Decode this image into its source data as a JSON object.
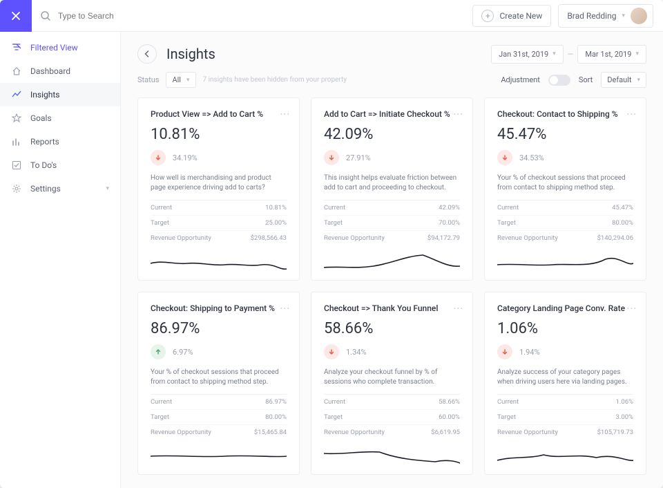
{
  "topbar": {
    "search_placeholder": "Type to Search",
    "create_label": "Create New",
    "user_name": "Brad Redding"
  },
  "sidebar": {
    "items": [
      {
        "label": "Filtered View",
        "icon": "filter"
      },
      {
        "label": "Dashboard",
        "icon": "home"
      },
      {
        "label": "Insights",
        "icon": "trend"
      },
      {
        "label": "Goals",
        "icon": "star"
      },
      {
        "label": "Reports",
        "icon": "bars"
      },
      {
        "label": "To Do's",
        "icon": "check"
      },
      {
        "label": "Settings",
        "icon": "gear"
      }
    ]
  },
  "header": {
    "title": "Insights",
    "date_from": "Jan 31st, 2019",
    "date_to": "Mar 1st, 2019"
  },
  "filter": {
    "status_label": "Status",
    "status_value": "All",
    "hidden_note": "7 insights have been hidden from your property",
    "adjustment_label": "Adjustment",
    "sort_label": "Sort",
    "sort_value": "Default"
  },
  "stat_labels": {
    "current": "Current",
    "target": "Target",
    "rev_opp": "Revenue Opportunity"
  },
  "cards": [
    {
      "title": "Product View => Add to Cart %",
      "value": "10.81%",
      "change_dir": "down",
      "change": "34.19%",
      "desc": "How well is merchandising and product page experience driving add to carts?",
      "current": "10.81%",
      "target": "25.00%",
      "rev_opp": "$298,566.43"
    },
    {
      "title": "Add to Cart => Initiate Checkout %",
      "value": "42.09%",
      "change_dir": "down",
      "change": "27.91%",
      "desc": "This insight helps evaluate friction between add to cart and proceeding to checkout.",
      "current": "42.09%",
      "target": "70.00%",
      "rev_opp": "$94,172.79"
    },
    {
      "title": "Checkout: Contact to Shipping %",
      "value": "45.47%",
      "change_dir": "down",
      "change": "34.53%",
      "desc": "Your % of checkout sessions that proceed from contact to shipping method step.",
      "current": "45.47%",
      "target": "80.00%",
      "rev_opp": "$140,294.06"
    },
    {
      "title": "Checkout: Shipping to Payment %",
      "value": "86.97%",
      "change_dir": "up",
      "change": "6.97%",
      "desc": "Your % of checkout sessions that proceed from contact to shipping method step.",
      "current": "86.97%",
      "target": "80.00%",
      "rev_opp": "$15,465.84"
    },
    {
      "title": "Checkout => Thank You Funnel",
      "value": "58.66%",
      "change_dir": "down",
      "change": "1.34%",
      "desc": "Analyze your checkout funnel by % of sessions who complete transaction.",
      "current": "58.66%",
      "target": "60.00%",
      "rev_opp": "$6,619.95"
    },
    {
      "title": "Category Landing Page Conv. Rate",
      "value": "1.06%",
      "change_dir": "down",
      "change": "1.94%",
      "desc": "Analyze success of your category pages when driving users here via landing pages.",
      "current": "1.06%",
      "target": "3.00%",
      "rev_opp": "$105,719.73"
    }
  ]
}
